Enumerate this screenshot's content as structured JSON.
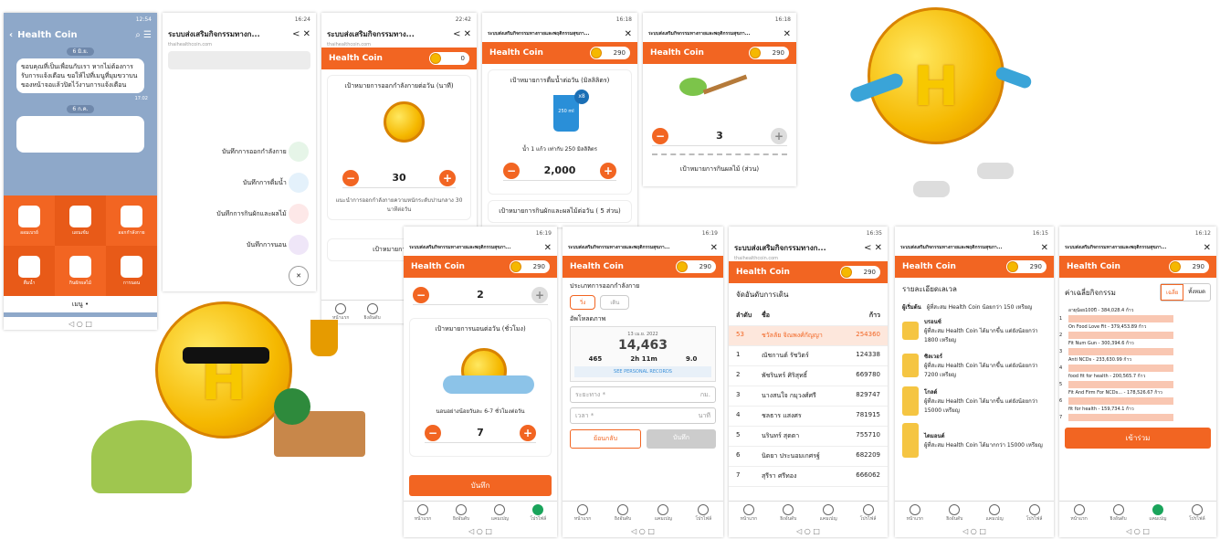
{
  "line": {
    "status": "12:54",
    "title": "Health Coin",
    "date1": "6 มิ.ย.",
    "msg": "ขอบคุณที่เป็นเพื่อนกับเรา หากไม่ต้องการรับการแจ้งเตือน ขอให้ไปที่เมนูที่มุมขวาบนของหน้าจอแล้วปิดไว้งานการแจ้งเตือน",
    "msg_time": "17:02",
    "date2": "6 ก.ค.",
    "menu": [
      "ออมเบรย์",
      "แผนเข้ม",
      "ออกกำลังกาย",
      "ดื่มน้ำ",
      "กินผักผลไม้",
      "การนอน"
    ],
    "menu_label": "เมนู •"
  },
  "p2": {
    "status": "16:24",
    "url_title": "ระบบส่งเสริมกิจกรรมทางก...",
    "domain": "thaihealthcoin.com",
    "items": [
      "บันทึกการออกกำลังกาย",
      "บันทึกการดื่มน้ำ",
      "บันทึกการกินผักและผลไม้",
      "บันทึกการนอน"
    ]
  },
  "p3": {
    "status": "22:42",
    "url_title": "ระบบส่งเสริมกิจกรรมทาง...",
    "domain": "thaihealthcoin.com",
    "hc": "Health Coin",
    "coins": "0",
    "goal": "เป้าหมายการออกกำลังกายต่อวัน (นาที)",
    "value": "30",
    "note": "แนะนำการออกกำลังกายความหนักระดับปานกลาง 30 นาทีต่อวัน",
    "next": "เป้าหมายการดื่มน้ำ"
  },
  "p4": {
    "status": "16:18",
    "url_title": "ระบบส่งเสริมกิจกรรมทางกายและพฤติกรรมสุขภา...",
    "hc": "Health Coin",
    "coins": "290",
    "goal": "เป้าหมายการดื่มน้ำต่อวัน (มิลลิลิตร)",
    "glass_badge": "x8",
    "glass_label": "250 ml",
    "note": "น้ำ 1 แก้ว เท่ากับ 250 มิลลิลิตร",
    "value": "2,000",
    "next": "เป้าหมายการกินผักและผลไม้ต่อวัน ( 5 ส่วน)"
  },
  "p5": {
    "status": "16:18",
    "url_title": "ระบบส่งเสริมกิจกรรมทางกายและพฤติกรรมสุขภา...",
    "hc": "Health Coin",
    "coins": "290",
    "value": "3",
    "goal": "เป้าหมายการกินผลไม้ (ส่วน)"
  },
  "p6": {
    "status": "16:19",
    "url_title": "ระบบส่งเสริมกิจกรรมทางกายและพฤติกรรมสุขภา...",
    "hc": "Health Coin",
    "coins": "290",
    "value_top": "2",
    "goal": "เป้าหมายการนอนต่อวัน (ชั่วโมง)",
    "note": "นอนอย่างน้อยวันละ 6-7 ชั่วโมงต่อวัน",
    "value": "7",
    "save": "บันทึก"
  },
  "p7": {
    "status": "16:19",
    "url_title": "ระบบส่งเสริมกิจกรรมทางกายและพฤติกรรมสุขภา...",
    "hc": "Health Coin",
    "coins": "290",
    "type_label": "ประเภทการออกกำลังกาย",
    "chips": [
      "วิ่ง",
      "เดิน"
    ],
    "upload": "อัพโหลดภาพ",
    "date": "13 เม.ย. 2022",
    "steps": "14,463",
    "s1": "465",
    "s2": "2h 11m",
    "s3": "9.0",
    "records": "SEE PERSONAL RECORDS",
    "distance": "ระยะทาง *",
    "unit_km": "กม.",
    "time": "เวลา *",
    "unit_min": "นาที",
    "back": "ย้อนกลับ",
    "save": "บันทึก"
  },
  "p8": {
    "status": "16:35",
    "url_title": "ระบบส่งเสริมกิจกรรมทางก...",
    "domain": "thaihealthcoin.com",
    "hc": "Health Coin",
    "coins": "290",
    "heading": "จัดอันดับการเดิน",
    "cols": [
      "ลำดับ",
      "ชื่อ",
      "ก้าว"
    ],
    "rows": [
      [
        "53",
        "ชวัลลัย จิณพงศ์กัญญา",
        "254360"
      ],
      [
        "1",
        "ณัชกานต์ รัชวิตร์",
        "124338"
      ],
      [
        "2",
        "พัชรินทร์ ศิริสุทธิ์",
        "669780"
      ],
      [
        "3",
        "นางสนใจ กมุวงศ์ศรี",
        "829747"
      ],
      [
        "4",
        "ชลธาร แสงศร",
        "781915"
      ],
      [
        "5",
        "นรินทร์ สุดตา",
        "755710"
      ],
      [
        "6",
        "นิตยา ประนอมเกศรฐ์",
        "682209"
      ],
      [
        "7",
        "สุรีรา ศรีทอง",
        "666062"
      ]
    ]
  },
  "p9": {
    "status": "16:15",
    "url_title": "ระบบส่งเสริมกิจกรรมทางกายและพฤติกรรมสุขภา...",
    "hc": "Health Coin",
    "coins": "290",
    "heading": "รายละเอียดเลเวล",
    "intro_l": "ผู้เริ่มต้น",
    "intro": "ผู้ที่สะสม Health Coin น้อยกว่า 150 เหรียญ",
    "levels": [
      [
        "บรอนซ์",
        "ผู้ที่สะสม Health Coin ได้มากขึ้น แต่ยังน้อยกว่า 1800 เหรียญ"
      ],
      [
        "ซิลเวอร์",
        "ผู้ที่สะสม Health Coin ได้มากขึ้น แต่ยังน้อยกว่า 7200 เหรียญ"
      ],
      [
        "โกลด์",
        "ผู้ที่สะสม Health Coin ได้มากขึ้น แต่ยังน้อยกว่า 15000 เหรียญ"
      ],
      [
        "ไดมอนด์",
        "ผู้ที่สะสม Health Coin ได้มากกว่า 15000 เหรียญ"
      ]
    ]
  },
  "p10": {
    "status": "16:12",
    "url_title": "ระบบส่งเสริมกิจกรรมทางกายและพฤติกรรมสุขภา...",
    "hc": "Health Coin",
    "coins": "290",
    "heading": "ค่าเฉลี่ยกิจกรรม",
    "tabs": [
      "เฉลี่ย",
      "ทั้งหมด"
    ],
    "bars": [
      [
        "อายุน้อย100ปี - 384,028.4 ก้าว",
        "1"
      ],
      [
        "On Food Love Fit - 379,453.89 ก้าว",
        "2"
      ],
      [
        "Fit Num Gun - 300,394.6 ก้าว",
        "3"
      ],
      [
        "Anti NCDs - 233,630.99 ก้าว",
        "4"
      ],
      [
        "food fit for health - 200,565.7 ก้าว",
        "5"
      ],
      [
        "Fit And Firm For NCDs... - 178,526.67 ก้าว",
        "6"
      ],
      [
        "fit for health - 159,734.1 ก้าว",
        "7"
      ]
    ],
    "join": "เข้าร่วม"
  },
  "nav": [
    "หน้าแรก",
    "ยิงอันดับ",
    "แคมเปญ",
    "โปรไฟล์"
  ],
  "mascot": "H"
}
